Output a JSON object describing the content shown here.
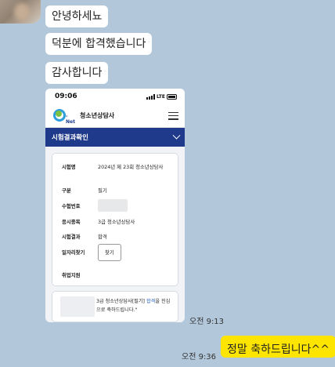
{
  "chat": {
    "messages_in": [
      "안녕하세뇨",
      "덕분에 합격했습니다",
      "감사합니다"
    ],
    "time_in": "오전 9:13",
    "message_out": "정말 축하드립니다^^",
    "time_out": "오전 9:36",
    "tail_mark": "'"
  },
  "phone": {
    "time": "09:06",
    "network": "LTE",
    "battery": "51",
    "logo_text": "-Net",
    "org_title": "청소년상담사",
    "section_title": "시험결과확인",
    "rows": [
      {
        "label": "시험명",
        "value": "2024년 제 23회 청소년상담사"
      },
      {
        "label": "구분",
        "value": "필기"
      },
      {
        "label": "수험번호",
        "value": ""
      },
      {
        "label": "응시종목",
        "value": "3급 청소년상담사"
      },
      {
        "label": "시험결과",
        "value": "합격"
      },
      {
        "label": "일자리찾기",
        "value": "찾기"
      },
      {
        "label": "취업지원",
        "value": ""
      }
    ],
    "notice": {
      "pre": "3급 청소년상담사[필기] ",
      "highlight": "합격",
      "post": "을 진심으로 축하드립니다.\""
    }
  }
}
